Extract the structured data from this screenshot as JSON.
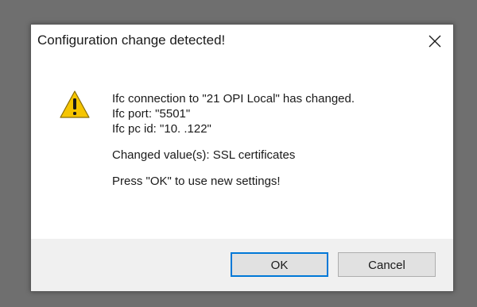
{
  "dialog": {
    "title": "Configuration change detected!",
    "close_icon": "close-icon",
    "warning_icon": "warning-triangle-icon",
    "message": {
      "line1": "Ifc connection to \"21 OPI Local\" has changed.",
      "line2": "Ifc port:  \"5501\"",
      "line3": "Ifc pc id:  \"10.            .122\"",
      "changed": "Changed value(s): SSL certificates",
      "prompt": "Press \"OK\" to use new settings!"
    },
    "buttons": {
      "ok": "OK",
      "cancel": "Cancel"
    }
  },
  "colors": {
    "backdrop": "#6f6f6f",
    "dialog_background": "#ffffff",
    "footer_background": "#f0f0f0",
    "button_background": "#e1e1e1",
    "default_button_border": "#0078d7",
    "warning_yellow": "#f6c500"
  }
}
